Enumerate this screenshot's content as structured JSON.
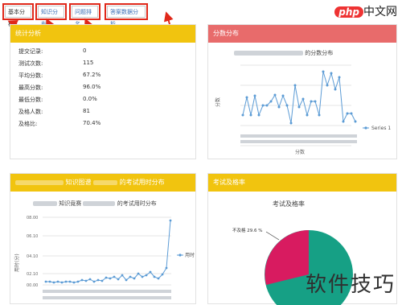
{
  "tabs": [
    {
      "label": "基本分析"
    },
    {
      "label": "知识分布"
    },
    {
      "label": "问题排名"
    },
    {
      "label": "答案数据分析"
    }
  ],
  "logo": {
    "brand": "php",
    "text": "中文网"
  },
  "stats_panel": {
    "title": "统计分析",
    "rows": [
      {
        "label": "提交记录:",
        "value": "0"
      },
      {
        "label": "测试次数:",
        "value": "115"
      },
      {
        "label": "平均分数:",
        "value": "67.2%"
      },
      {
        "label": "最高分数:",
        "value": "96.0%"
      },
      {
        "label": "最低分数:",
        "value": "0.0%"
      },
      {
        "label": "及格人数:",
        "value": "81"
      },
      {
        "label": "及格比:",
        "value": "70.4%"
      }
    ]
  },
  "score_panel": {
    "title": "分数分布",
    "chart_title_suffix": "的分数分布",
    "legend": "Series 1",
    "yaxis_title": "分数",
    "xaxis_title": "分数"
  },
  "time_panel": {
    "title_mid": "知识图谱",
    "title_suffix": "的考试用时分布",
    "chart_title_mid": "知识竟赛",
    "chart_title_suffix": "的考试用时分布",
    "legend": "用时",
    "yaxis_title": "用时(分)",
    "yticks": [
      "00.00",
      "02.10",
      "04.10",
      "06.10",
      "08.00"
    ]
  },
  "pass_panel": {
    "title": "考试及格率",
    "chart_title": "考试及格率",
    "fail_label": "不及格 29.6 %"
  },
  "watermark": "软件技巧",
  "colors": {
    "yellow": "#f1c40f",
    "red": "#e86b6b",
    "pink": "#d81b60",
    "teal": "#16a085",
    "line": "#5b9bd5"
  }
}
